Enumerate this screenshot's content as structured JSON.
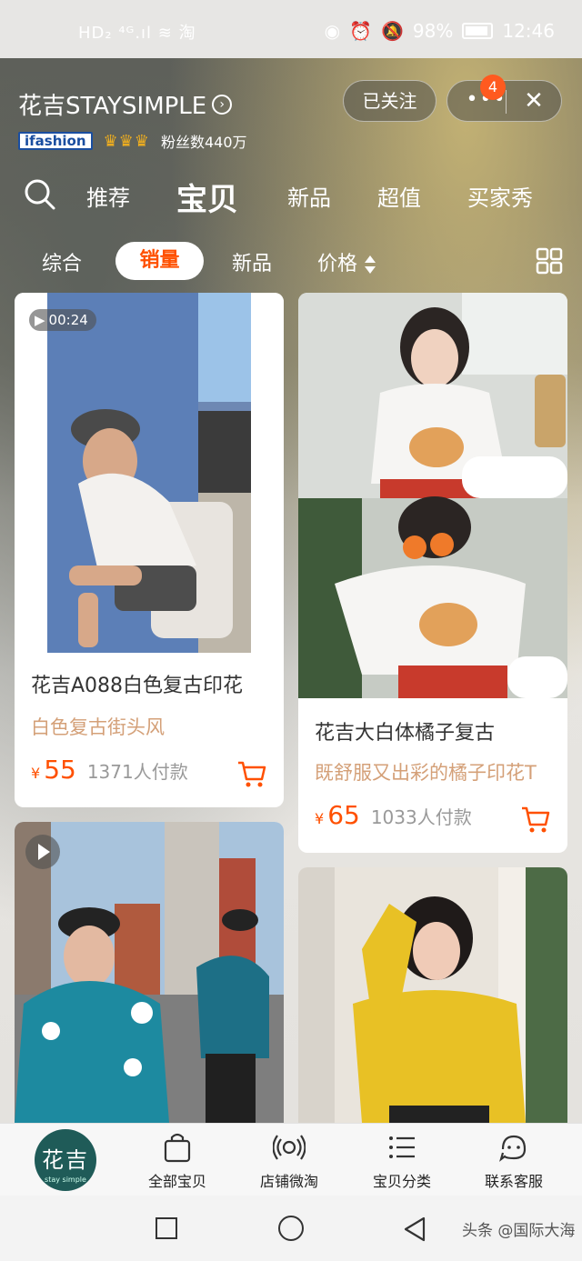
{
  "status_bar": {
    "left": "HD₂ ⁴ᴳ.ıl ≋ 淘",
    "battery": "98%",
    "time": "12:46"
  },
  "header": {
    "shop_name": "花吉STAYSIMPLE",
    "follow_label": "已关注",
    "more_label": "•••",
    "badge_count": "4",
    "close_label": "✕",
    "ifashion": "ifashion",
    "crowns": "♛♛♛",
    "fans": "粉丝数440万"
  },
  "main_tabs": [
    {
      "label": "推荐",
      "active": false
    },
    {
      "label": "宝贝",
      "active": true
    },
    {
      "label": "新品",
      "active": false
    },
    {
      "label": "超值",
      "active": false
    },
    {
      "label": "买家秀",
      "active": false
    }
  ],
  "sub_tabs": [
    {
      "label": "综合"
    },
    {
      "label": "销量",
      "active": true
    },
    {
      "label": "新品"
    },
    {
      "label": "价格"
    }
  ],
  "products": [
    {
      "video_duration": "00:24",
      "title": "花吉A088白色复古印花",
      "subtitle": "白色复古街头风",
      "currency": "¥",
      "price": "55",
      "sold": "1371人付款"
    },
    {
      "title": "花吉大白体橘子复古",
      "subtitle": "既舒服又出彩的橘子印花T",
      "currency": "¥",
      "price": "65",
      "sold": "1033人付款"
    }
  ],
  "bottom_nav": {
    "logo_text": "花吉",
    "logo_sub": "stay simple",
    "items": [
      {
        "label": "全部宝贝",
        "icon": "bag-icon"
      },
      {
        "label": "店铺微淘",
        "icon": "broadcast-icon"
      },
      {
        "label": "宝贝分类",
        "icon": "list-icon"
      },
      {
        "label": "联系客服",
        "icon": "service-icon"
      }
    ]
  },
  "watermark": "头条 @国际大海",
  "colors": {
    "accent": "#ff5000",
    "subtitle": "#d4a078",
    "logo": "#1f5b58"
  }
}
